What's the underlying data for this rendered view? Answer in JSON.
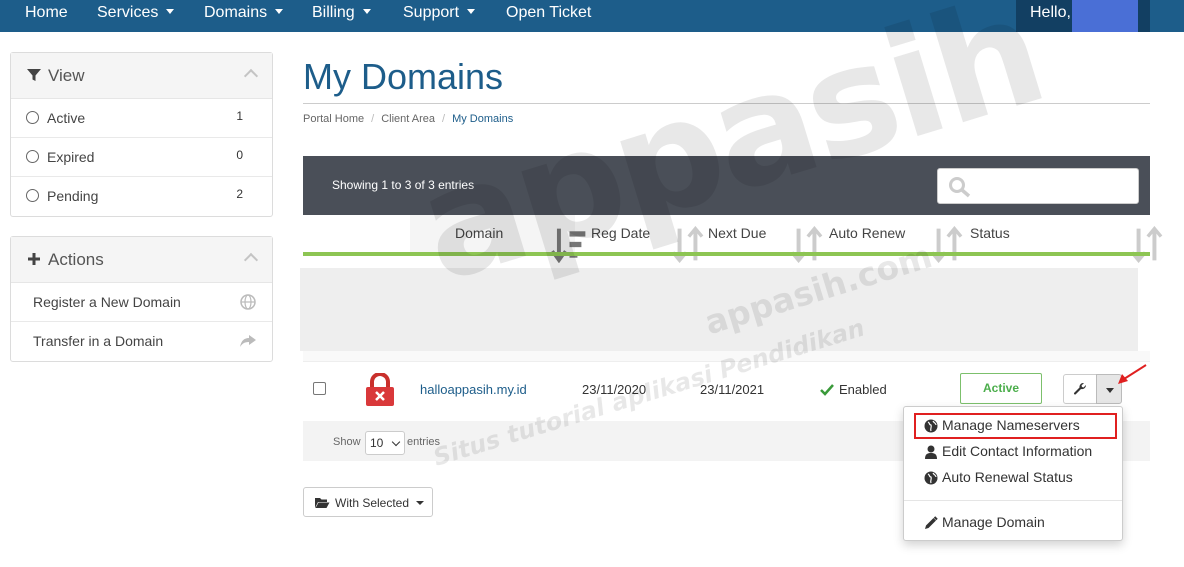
{
  "nav": {
    "home": "Home",
    "services": "Services",
    "domains": "Domains",
    "billing": "Billing",
    "support": "Support",
    "open_ticket": "Open Ticket",
    "hello": "Hello,"
  },
  "sidebar": {
    "view": {
      "title": "View",
      "items": [
        {
          "label": "Active",
          "count": "1"
        },
        {
          "label": "Expired",
          "count": "0"
        },
        {
          "label": "Pending",
          "count": "2"
        }
      ]
    },
    "actions": {
      "title": "Actions",
      "items": [
        {
          "label": "Register a New Domain",
          "icon": "globe-icon"
        },
        {
          "label": "Transfer in a Domain",
          "icon": "share-arrow-icon"
        }
      ]
    }
  },
  "page": {
    "title": "My Domains",
    "breadcrumb": [
      "Portal Home",
      "Client Area",
      "My Domains"
    ]
  },
  "table": {
    "info": "Showing 1 to 3 of 3 entries",
    "columns": [
      "Domain",
      "Reg Date",
      "Next Due",
      "Auto Renew",
      "Status"
    ],
    "rows": [
      {
        "domain": "halloappasih.my.id",
        "reg_date": "23/11/2020",
        "next_due": "23/11/2021",
        "auto_renew": "Enabled",
        "status": "Active"
      }
    ],
    "footer": {
      "show": "Show",
      "page_size": "10",
      "entries": "entries"
    },
    "with_selected": "With Selected"
  },
  "dropdown": {
    "items": [
      {
        "label": "Manage Nameservers",
        "icon": "globe-icon"
      },
      {
        "label": "Edit Contact Information",
        "icon": "user-icon"
      },
      {
        "label": "Auto Renewal Status",
        "icon": "globe-icon"
      },
      {
        "label": "Manage Domain",
        "icon": "pencil-icon"
      }
    ]
  },
  "watermark": {
    "main": "appasih",
    "domain": "appasih.com",
    "tagline": "Situs tutorial aplikasi Pendidikan"
  },
  "colors": {
    "nav_bg": "#1d5d8a",
    "accent": "#1d5d8a",
    "green": "#8dc553",
    "status_green": "#4cae4c",
    "highlight_red": "#e02020"
  }
}
